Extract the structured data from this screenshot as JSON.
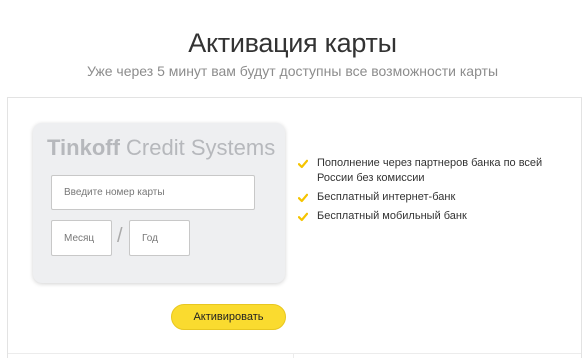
{
  "header": {
    "title": "Активация карты",
    "subtitle": "Уже через 5 минут вам будут доступны все возможности карты"
  },
  "card": {
    "brand_bold": "Tinkoff",
    "brand_light": "Credit Systems",
    "number_placeholder": "Введите номер карты",
    "month_placeholder": "Месяц",
    "separator": "/",
    "year_placeholder": "Год"
  },
  "benefits": [
    {
      "text": "Пополнение через партнеров банка по всей России без комиссии",
      "icon": "check-icon"
    },
    {
      "text": "Бесплатный интернет-банк",
      "icon": "check-icon"
    },
    {
      "text": "Бесплатный мобильный банк",
      "icon": "check-icon"
    }
  ],
  "actions": {
    "activate_label": "Активировать"
  },
  "colors": {
    "accent": "#fadb2f",
    "check": "#f5c400"
  }
}
